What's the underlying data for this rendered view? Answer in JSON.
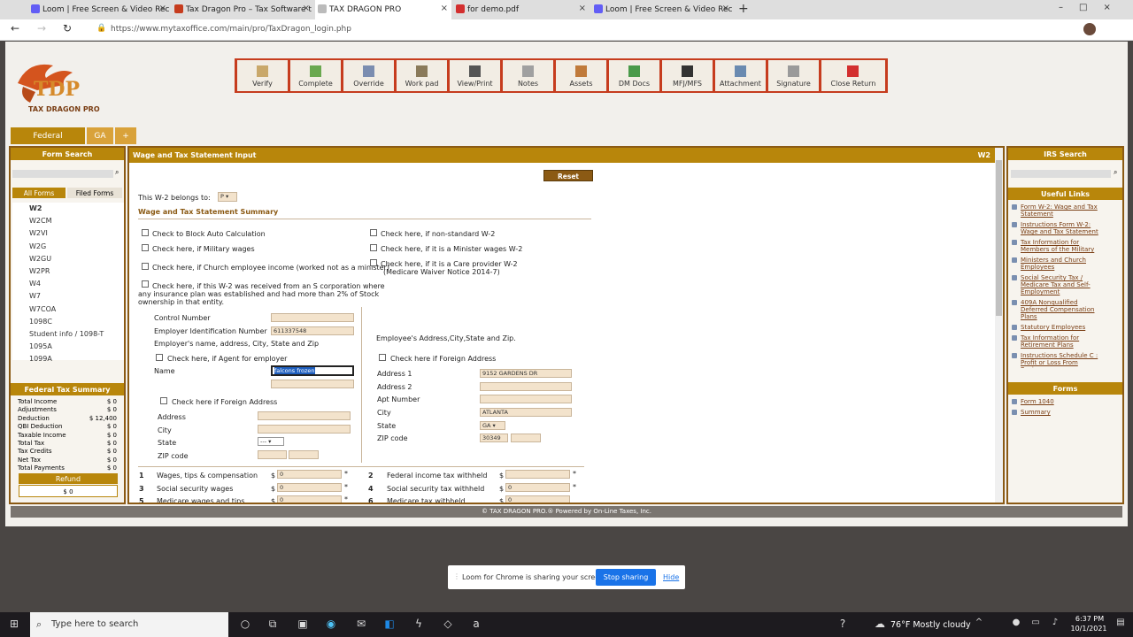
{
  "browser": {
    "tabs": [
      {
        "title": "Loom | Free Screen & Video Rec",
        "color": "#625df5"
      },
      {
        "title": "Tax Dragon Pro – Tax Software t",
        "color": "#c63c1e"
      },
      {
        "title": "TAX DRAGON PRO",
        "color": "#888888"
      },
      {
        "title": "for demo.pdf",
        "color": "#d32f2f"
      },
      {
        "title": "Loom | Free Screen & Video Rec",
        "color": "#625df5"
      }
    ],
    "url": "https://www.mytaxoffice.com/main/pro/TaxDragon_login.php"
  },
  "logo": {
    "text": "TDP",
    "subtitle": "TAX DRAGON PRO"
  },
  "toolbar": [
    "Verify",
    "Complete",
    "Override",
    "Work pad",
    "View/Print",
    "Notes",
    "Assets",
    "DM Docs",
    "MFJ/MFS",
    "Attachment",
    "Signature",
    "Close Return"
  ],
  "state_tabs": [
    "Federal",
    "GA",
    "+"
  ],
  "form_search": {
    "title": "Form Search",
    "tabs": [
      "All Forms",
      "Filed Forms"
    ],
    "items": [
      "W2",
      "W2CM",
      "W2VI",
      "W2G",
      "W2GU",
      "W2PR",
      "W4",
      "W7",
      "W7COA",
      "1098C",
      "Student info / 1098-T",
      "1095A",
      "1099A"
    ]
  },
  "fed_summary": {
    "title": "Federal Tax Summary",
    "rows": [
      {
        "label": "Total Income",
        "value": "$ 0"
      },
      {
        "label": "Adjustments",
        "value": "$ 0"
      },
      {
        "label": "Deduction",
        "value": "$ 12,400"
      },
      {
        "label": "QBI Deduction",
        "value": "$ 0"
      },
      {
        "label": "Taxable Income",
        "value": "$ 0"
      },
      {
        "label": "Total Tax",
        "value": "$ 0"
      },
      {
        "label": "Tax Credits",
        "value": "$ 0"
      },
      {
        "label": "Net Tax",
        "value": "$ 0"
      },
      {
        "label": "Total Payments",
        "value": "$ 0"
      }
    ],
    "refund_label": "Refund",
    "refund_value": "$ 0"
  },
  "main": {
    "title": "Wage and Tax Statement Input",
    "form_code": "W2",
    "reset": "Reset Screen",
    "belongs_label": "This W-2 belongs to:",
    "belongs_value": "P",
    "section_title": "Wage and Tax Statement Summary",
    "checks_left": [
      "Check to Block Auto Calculation",
      "Check here, if Military wages",
      "Check here, if Church employee income (worked not as a minister)"
    ],
    "check_scorp_1": "Check here, if this W-2 was received from an S corporation where",
    "check_scorp_2": "any insurance plan was established and had more than 2% of Stock",
    "check_scorp_3": "ownership in that entity.",
    "checks_right": [
      "Check here, if non-standard W-2",
      "Check here, if it is a Minister wages W-2",
      "Check here, if it is a Care provider W-2"
    ],
    "care_note": "(Medicare Waiver Notice 2014-7)",
    "control_number": "Control Number",
    "ein_label": "Employer Identification Number",
    "ein_value": "611337548",
    "employer_label": "Employer's name, address, City, State and Zip",
    "agent_check": "Check here, if Agent for employer",
    "name_label": "Name",
    "name_value": "falcons frozen",
    "foreign_check": "Check here if Foreign Address",
    "address_label": "Address",
    "city_label": "City",
    "state_label": "State",
    "state_value": "---",
    "zip_label": "ZIP code",
    "employee_label": "Employee's Address,City,State and Zip.",
    "emp_foreign_check": "Check here if Foreign Address",
    "addr1_label": "Address 1",
    "addr1_value": "9152 GARDENS DR",
    "addr2_label": "Address 2",
    "apt_label": "Apt Number",
    "emp_city_label": "City",
    "emp_city_value": "ATLANTA",
    "emp_state_label": "State",
    "emp_state_value": "GA",
    "emp_zip_label": "ZIP code",
    "emp_zip_value": "30349",
    "boxes": [
      {
        "num": "1",
        "label": "Wages, tips & compensation",
        "value": "0"
      },
      {
        "num": "2",
        "label": "Federal income tax withheld",
        "value": ""
      },
      {
        "num": "3",
        "label": "Social security wages",
        "value": "0"
      },
      {
        "num": "4",
        "label": "Social security tax withheld",
        "value": "0"
      },
      {
        "num": "5",
        "label": "Medicare wages and tips",
        "value": "0"
      },
      {
        "num": "6",
        "label": "Medicare tax withheld",
        "value": "0"
      }
    ]
  },
  "irs": {
    "title": "IRS Search",
    "useful_title": "Useful Links",
    "links": [
      "Form W-2: Wage and Tax Statement",
      "Instructions Form W-2: Wage and Tax Statement",
      "Tax Information for Members of the Military",
      "Ministers and Church Employees",
      "Social Security Tax / Medicare Tax and Self-Employment",
      "409A Nonqualified Deferred Compensation Plans",
      "Statutory Employees",
      "Tax Information for Retirement Plans",
      "Instructions Schedule C : Profit or Loss From Business"
    ],
    "forms_title": "Forms",
    "forms": [
      "Form 1040",
      "Summary"
    ]
  },
  "footer": "© TAX DRAGON PRO.® Powered by On-Line Taxes, Inc.",
  "loom": {
    "message": "Loom for Chrome is sharing your screen.",
    "stop": "Stop sharing",
    "hide": "Hide"
  },
  "taskbar": {
    "search": "Type here to search",
    "weather": "76°F  Mostly cloudy",
    "time": "6:37 PM",
    "date": "10/1/2021"
  }
}
